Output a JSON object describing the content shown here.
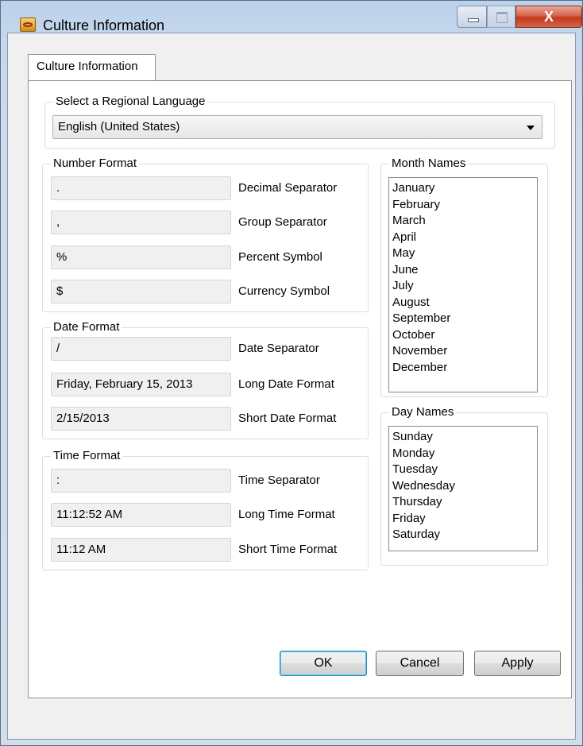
{
  "window": {
    "title": "Culture Information",
    "close_glyph": "X"
  },
  "tab": {
    "label": "Culture Information"
  },
  "language": {
    "group_label": "Select a Regional Language",
    "selected": "English (United States)"
  },
  "number_format": {
    "group_label": "Number Format",
    "decimal_value": ".",
    "decimal_label": "Decimal Separator",
    "group_value": ",",
    "group_label_text": "Group Separator",
    "percent_value": "%",
    "percent_label": "Percent Symbol",
    "currency_value": "$",
    "currency_label": "Currency Symbol"
  },
  "date_format": {
    "group_label": "Date Format",
    "separator_value": "/",
    "separator_label": "Date Separator",
    "long_value": "Friday, February 15, 2013",
    "long_label": "Long Date Format",
    "short_value": "2/15/2013",
    "short_label": "Short Date Format"
  },
  "time_format": {
    "group_label": "Time Format",
    "separator_value": ":",
    "separator_label": "Time Separator",
    "long_value": "11:12:52 AM",
    "long_label": "Long Time Format",
    "short_value": "11:12 AM",
    "short_label": "Short Time Format"
  },
  "month_names": {
    "group_label": "Month Names",
    "items": [
      "January",
      "February",
      "March",
      "April",
      "May",
      "June",
      "July",
      "August",
      "September",
      "October",
      "November",
      "December"
    ]
  },
  "day_names": {
    "group_label": "Day Names",
    "items": [
      "Sunday",
      "Monday",
      "Tuesday",
      "Wednesday",
      "Thursday",
      "Friday",
      "Saturday"
    ]
  },
  "buttons": {
    "ok": "OK",
    "cancel": "Cancel",
    "apply": "Apply"
  }
}
